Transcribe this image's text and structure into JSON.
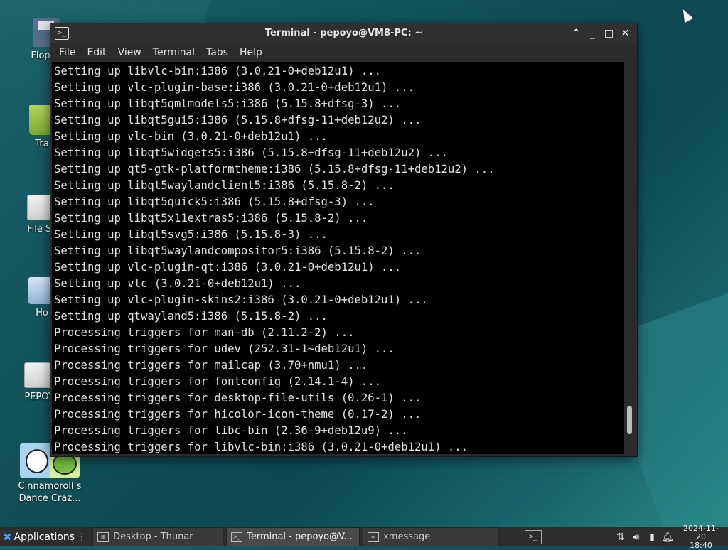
{
  "desktop": {
    "icons": [
      {
        "label": "Floppy"
      },
      {
        "label": "Tra"
      },
      {
        "label": "File Sy"
      },
      {
        "label": "Ho"
      },
      {
        "label": "PEPOY"
      },
      {
        "label": "Cinnamoroll’s Dance Craz..."
      }
    ]
  },
  "window": {
    "title": "Terminal - pepoyo@VM8-PC: ~",
    "app_icon": ">_",
    "controls": {
      "shade": "⌃",
      "minimize": "_",
      "maximize": "□",
      "close": "✕"
    },
    "menu": [
      "File",
      "Edit",
      "View",
      "Terminal",
      "Tabs",
      "Help"
    ]
  },
  "terminal": {
    "lines": [
      "Setting up libvlc-bin:i386 (3.0.21-0+deb12u1) ...",
      "Setting up vlc-plugin-base:i386 (3.0.21-0+deb12u1) ...",
      "Setting up libqt5qmlmodels5:i386 (5.15.8+dfsg-3) ...",
      "Setting up libqt5gui5:i386 (5.15.8+dfsg-11+deb12u2) ...",
      "Setting up vlc-bin (3.0.21-0+deb12u1) ...",
      "Setting up libqt5widgets5:i386 (5.15.8+dfsg-11+deb12u2) ...",
      "Setting up qt5-gtk-platformtheme:i386 (5.15.8+dfsg-11+deb12u2) ...",
      "Setting up libqt5waylandclient5:i386 (5.15.8-2) ...",
      "Setting up libqt5quick5:i386 (5.15.8+dfsg-3) ...",
      "Setting up libqt5x11extras5:i386 (5.15.8-2) ...",
      "Setting up libqt5svg5:i386 (5.15.8-3) ...",
      "Setting up libqt5waylandcompositor5:i386 (5.15.8-2) ...",
      "Setting up vlc-plugin-qt:i386 (3.0.21-0+deb12u1) ...",
      "Setting up vlc (3.0.21-0+deb12u1) ...",
      "Setting up vlc-plugin-skins2:i386 (3.0.21-0+deb12u1) ...",
      "Setting up qtwayland5:i386 (5.15.8-2) ...",
      "Processing triggers for man-db (2.11.2-2) ...",
      "Processing triggers for udev (252.31-1~deb12u1) ...",
      "Processing triggers for mailcap (3.70+nmu1) ...",
      "Processing triggers for fontconfig (2.14.1-4) ...",
      "Processing triggers for desktop-file-utils (0.26-1) ...",
      "Processing triggers for hicolor-icon-theme (0.17-2) ...",
      "Processing triggers for libc-bin (2.36-9+deb12u9) ...",
      "Processing triggers for libvlc-bin:i386 (3.0.21-0+deb12u1) ..."
    ]
  },
  "taskbar": {
    "apps_label": "Applications",
    "tasks": [
      {
        "label": "Desktop - Thunar",
        "icon": "folder-icon"
      },
      {
        "label": "Terminal - pepoyo@V...",
        "icon": "terminal-icon"
      },
      {
        "label": "xmessage",
        "icon": "window-icon"
      }
    ],
    "clock": {
      "date": "2024-11-20",
      "time": "18:40"
    }
  }
}
